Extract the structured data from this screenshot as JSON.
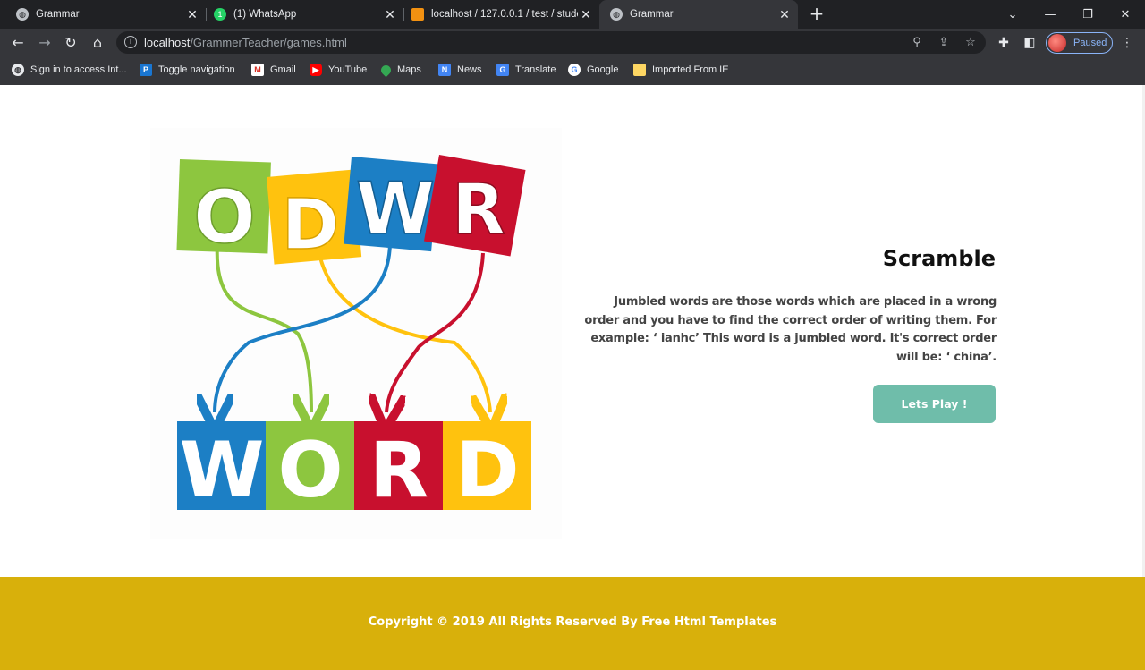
{
  "browser": {
    "tabs": [
      {
        "label": "Grammar",
        "active": false
      },
      {
        "label": "(1) WhatsApp",
        "active": false
      },
      {
        "label": "localhost / 127.0.0.1 / test / stude",
        "active": false
      },
      {
        "label": "Grammar",
        "active": true
      }
    ],
    "url_host": "localhost",
    "url_path": "/GrammerTeacher/games.html",
    "profile_status": "Paused",
    "bookmarks": [
      {
        "label": "Sign in to access Int...",
        "icon": "globe-icon"
      },
      {
        "label": "Toggle navigation",
        "icon": "pointer-icon"
      },
      {
        "label": "Gmail",
        "icon": "gmail-icon"
      },
      {
        "label": "YouTube",
        "icon": "youtube-icon"
      },
      {
        "label": "Maps",
        "icon": "maps-icon"
      },
      {
        "label": "News",
        "icon": "news-icon"
      },
      {
        "label": "Translate",
        "icon": "translate-icon"
      },
      {
        "label": "Google",
        "icon": "google-icon"
      },
      {
        "label": "Imported From IE",
        "icon": "folder-icon"
      }
    ]
  },
  "game": {
    "title": "Scramble",
    "description": "Jumbled words are those words which are placed in a wrong order and you have to find the correct order of writing them. For example: ‘ ianhc’ This word is a jumbled word. It's correct order will be: ‘ china’.",
    "play_label": "Lets Play !",
    "image": {
      "scrambled_letters": [
        "O",
        "D",
        "W",
        "R"
      ],
      "word_letters": [
        "W",
        "O",
        "R",
        "D"
      ]
    }
  },
  "footer": {
    "copyright": "Copyright © 2019 All Rights Reserved By Free Html Templates"
  },
  "colors": {
    "accent_button": "#6fbdaa",
    "footer": "#d8b00b",
    "tile_green": "#8dc63f",
    "tile_yellow": "#ffc20e",
    "tile_blue": "#1c7fc5",
    "tile_red": "#c8102e"
  }
}
